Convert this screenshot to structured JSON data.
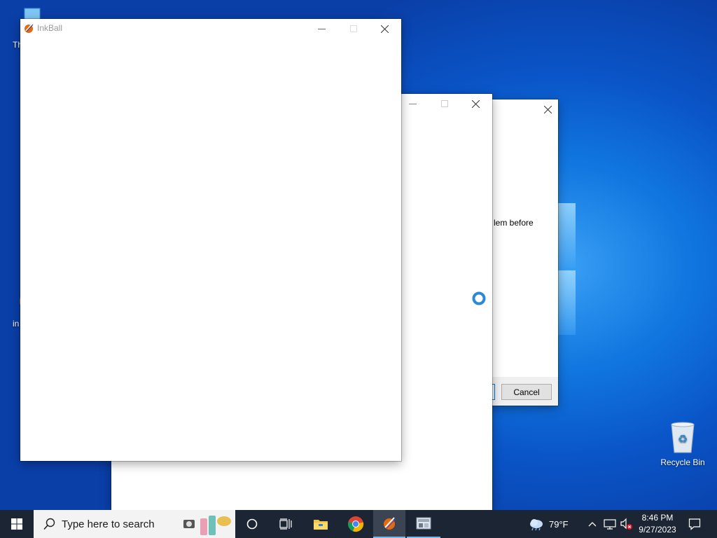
{
  "desktop": {
    "icons": [
      {
        "label": "Th",
        "icon": "this-pc-icon"
      },
      {
        "label": "in",
        "icon": "inkball-shortcut-icon"
      },
      {
        "label": "Recycle Bin",
        "icon": "recycle-bin-icon"
      }
    ]
  },
  "windows": {
    "inkball": {
      "title": "InkBall"
    },
    "dialog": {
      "partial_text": "lem before",
      "cancel_label": "Cancel"
    }
  },
  "taskbar": {
    "search_placeholder": "Type here to search",
    "weather": {
      "temp": "79°F"
    },
    "clock": {
      "time": "8:46 PM",
      "date": "9/27/2023"
    },
    "apps": [
      "start-icon",
      "search-icon",
      "cortana-icon",
      "task-view-icon",
      "file-explorer-icon",
      "chrome-icon",
      "inkball-icon",
      "control-panel-icon"
    ]
  },
  "colors": {
    "desktop_blue": "#0a55c8",
    "taskbar": "#1c2533",
    "loading_ring": "#2b88d8"
  }
}
